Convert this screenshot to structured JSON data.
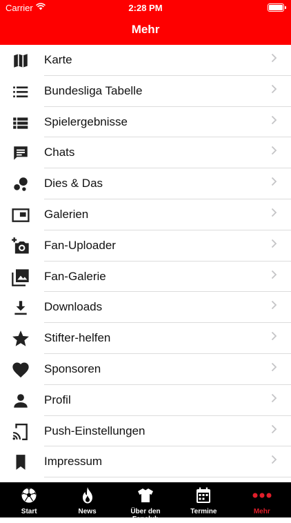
{
  "status": {
    "carrier": "Carrier",
    "time": "2:28 PM"
  },
  "header": {
    "title": "Mehr"
  },
  "menu": [
    {
      "label": "Karte",
      "icon": "map-icon"
    },
    {
      "label": "Bundesliga Tabelle",
      "icon": "list-icon"
    },
    {
      "label": "Spielergebnisse",
      "icon": "list-detail-icon"
    },
    {
      "label": "Chats",
      "icon": "chat-icon"
    },
    {
      "label": "Dies & Das",
      "icon": "bubbles-icon"
    },
    {
      "label": "Galerien",
      "icon": "picture-in-picture-icon"
    },
    {
      "label": "Fan-Uploader",
      "icon": "add-camera-icon"
    },
    {
      "label": "Fan-Galerie",
      "icon": "photo-library-icon"
    },
    {
      "label": "Downloads",
      "icon": "download-icon"
    },
    {
      "label": "Stifter-helfen",
      "icon": "star-icon"
    },
    {
      "label": "Sponsoren",
      "icon": "heart-icon"
    },
    {
      "label": "Profil",
      "icon": "person-icon"
    },
    {
      "label": "Push-Einstellungen",
      "icon": "cast-icon"
    },
    {
      "label": "Impressum",
      "icon": "bookmark-icon"
    }
  ],
  "tabs": [
    {
      "label": "Start",
      "icon": "soccer-ball-icon",
      "active": false
    },
    {
      "label": "News",
      "icon": "flame-icon",
      "active": false
    },
    {
      "label": "Über den Fanclub",
      "icon": "jersey-icon",
      "active": false
    },
    {
      "label": "Termine",
      "icon": "calendar-icon",
      "active": false
    },
    {
      "label": "Mehr",
      "icon": "more-dots-icon",
      "active": true
    }
  ],
  "colors": {
    "header": "#fe0000",
    "tabbar": "#000000",
    "active_tab": "#e01e2a"
  }
}
